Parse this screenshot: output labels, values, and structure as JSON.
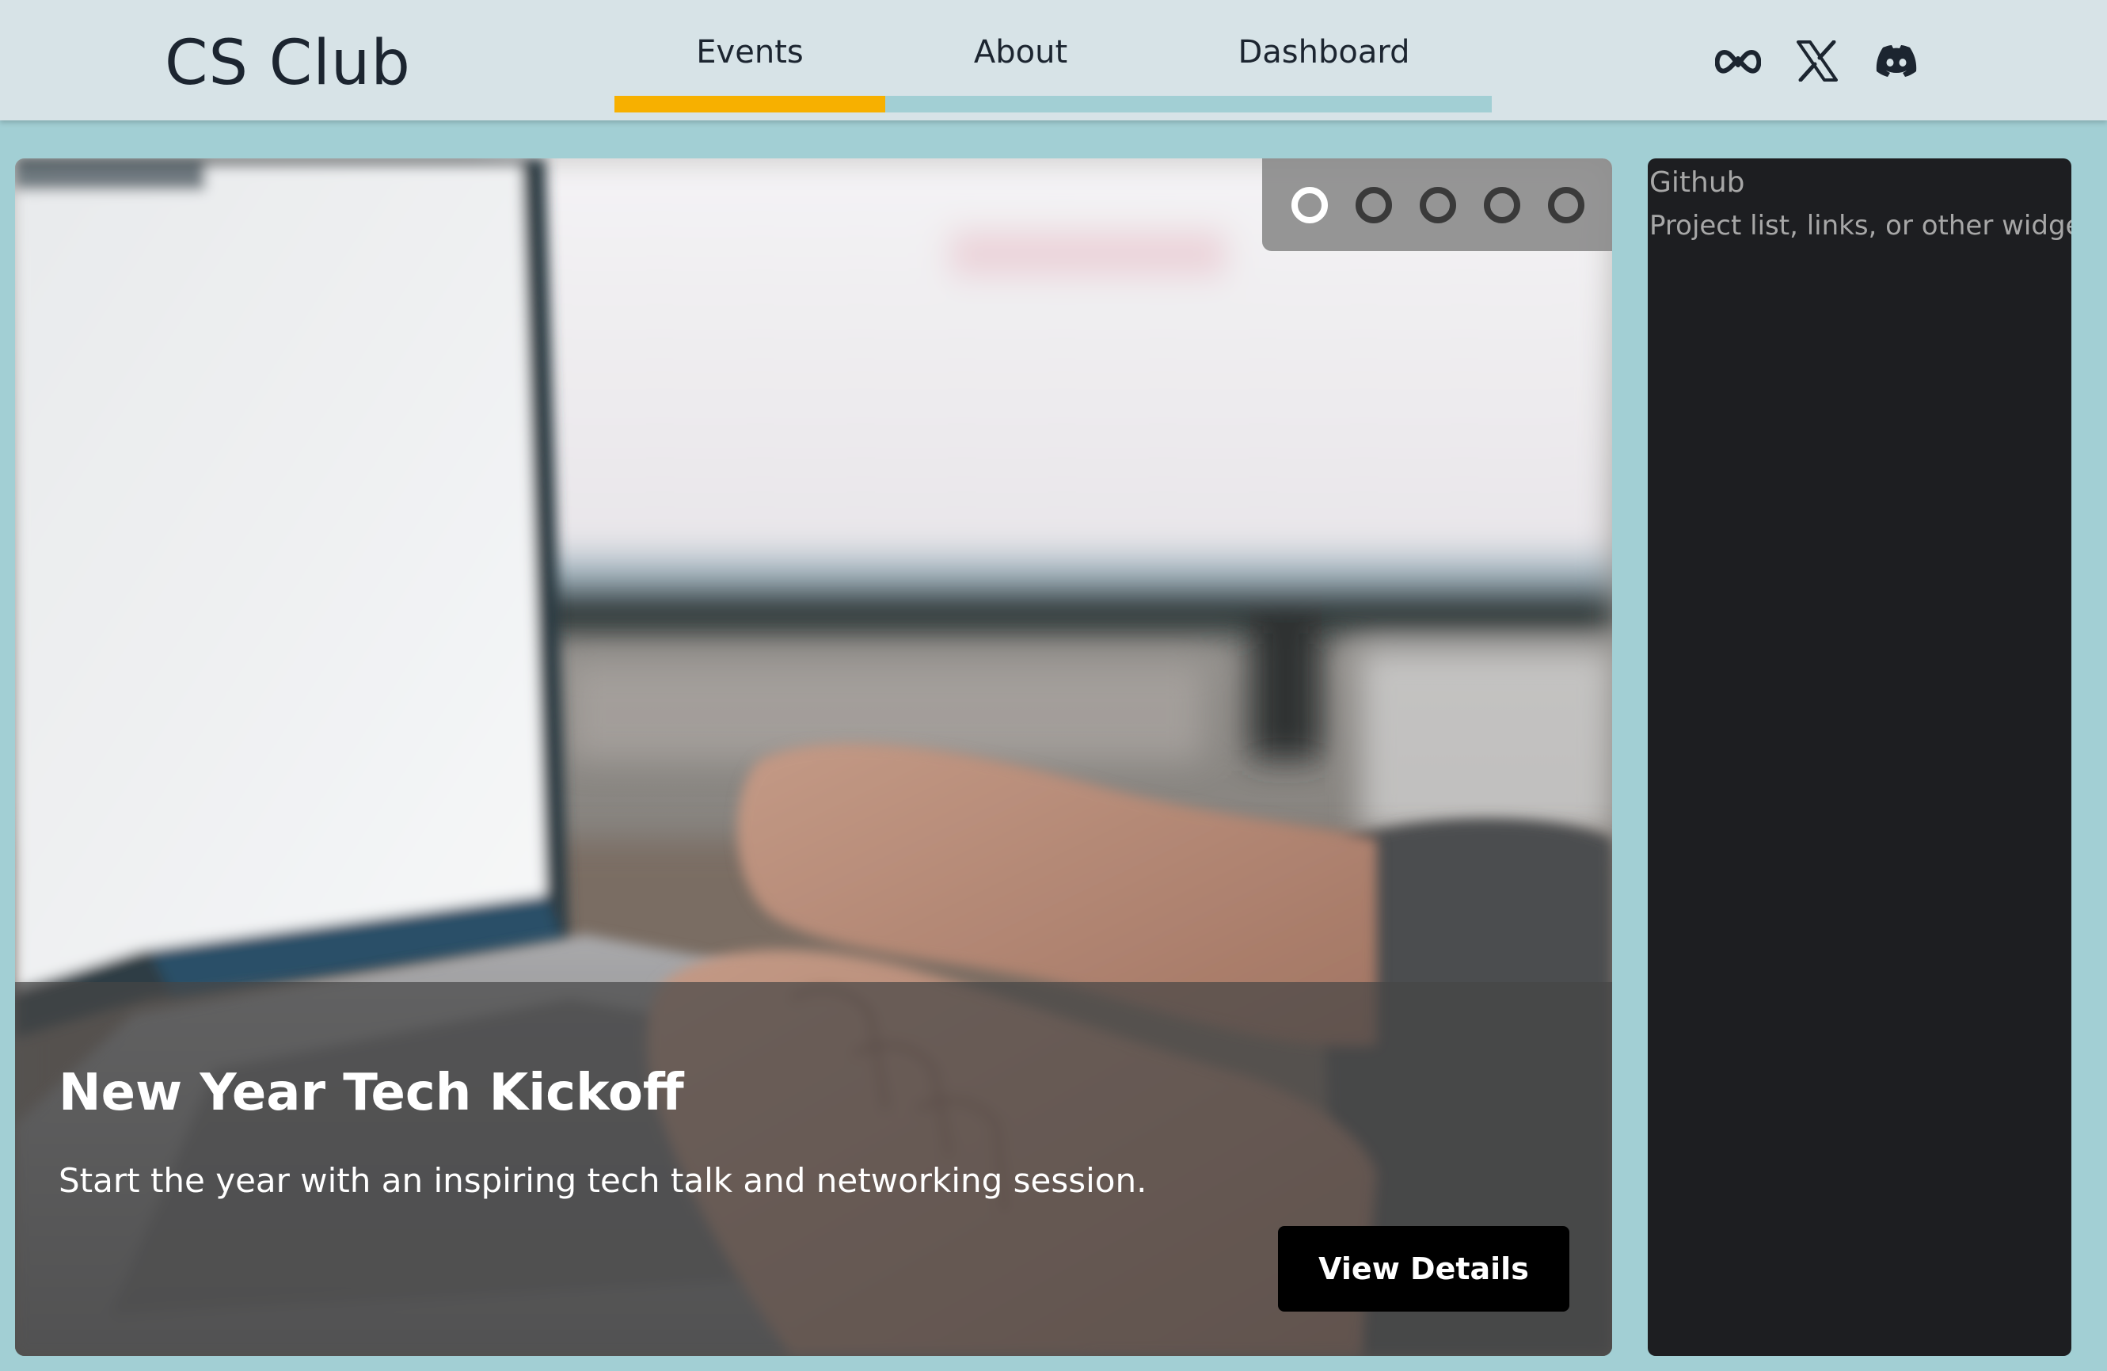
{
  "header": {
    "logo": "CS Club",
    "nav": [
      {
        "label": "Events",
        "active": true
      },
      {
        "label": "About",
        "active": false
      },
      {
        "label": "Dashboard",
        "active": false
      }
    ],
    "socials": [
      "meta-icon",
      "x-icon",
      "discord-icon"
    ]
  },
  "hero": {
    "slide_count": 5,
    "active_slide": 1,
    "title": "New Year Tech Kickoff",
    "description": "Start the year with an inspiring tech talk and networking session.",
    "button_label": "View Details"
  },
  "sidebar": {
    "title": "Github",
    "text": "Project list, links, or other widgets"
  },
  "colors": {
    "background": "#a2cfd4",
    "header": "#d7e3e7",
    "accent": "#f7b000",
    "panel": "#1d1e21",
    "button": "#000000"
  }
}
